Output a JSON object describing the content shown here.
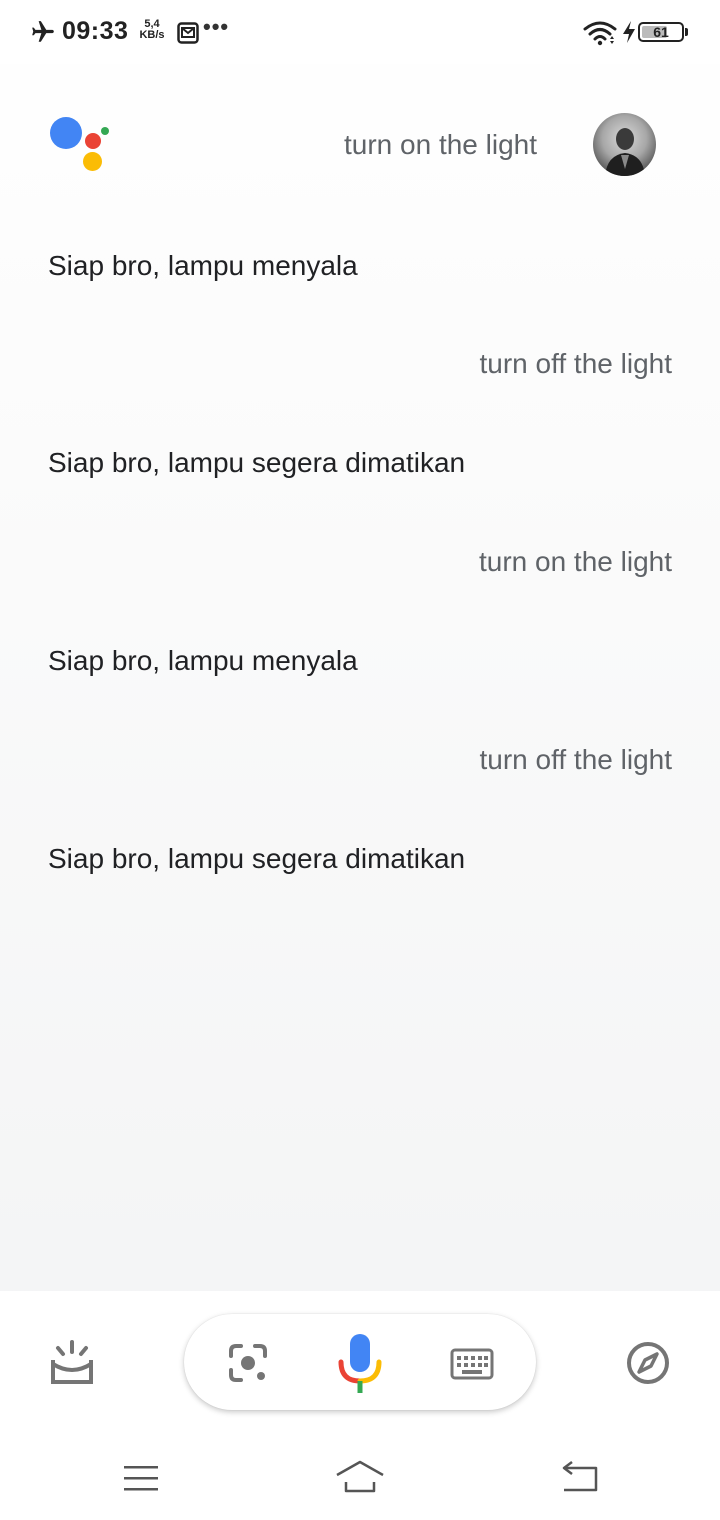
{
  "status_bar": {
    "time": "09:33",
    "net_speed_value": "5,4",
    "net_speed_unit": "KB/s",
    "more_indicator": "•••",
    "battery_level": "61"
  },
  "conversation": [
    {
      "role": "user",
      "text": "turn on the light"
    },
    {
      "role": "assistant",
      "text": "Siap bro, lampu menyala"
    },
    {
      "role": "user",
      "text": "turn off the light"
    },
    {
      "role": "assistant",
      "text": "Siap bro, lampu segera dimatikan"
    },
    {
      "role": "user",
      "text": "turn on the light"
    },
    {
      "role": "assistant",
      "text": "Siap bro, lampu menyala"
    },
    {
      "role": "user",
      "text": "turn off the light"
    },
    {
      "role": "assistant",
      "text": "Siap bro, lampu segera dimatikan"
    }
  ],
  "icons": {
    "status": [
      "airplane-mode-icon",
      "notification-app-icon",
      "wifi-icon",
      "charging-icon",
      "battery-icon"
    ],
    "header": [
      "google-assistant-logo",
      "user-avatar"
    ],
    "bottom_bar": [
      "updates-icon",
      "google-lens-icon",
      "microphone-icon",
      "keyboard-icon",
      "explore-compass-icon"
    ],
    "navigation": [
      "menu-icon",
      "home-icon",
      "back-icon"
    ]
  },
  "colors": {
    "google_blue": "#4285F4",
    "google_red": "#EA4335",
    "google_yellow": "#FBBC05",
    "google_green": "#34A853",
    "icon_gray": "#757575",
    "query_text": "#5f6368",
    "reply_text": "#202124"
  }
}
